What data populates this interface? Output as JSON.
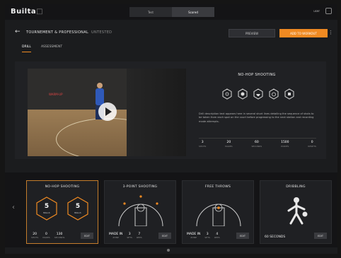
{
  "app": {
    "logo": "Builta",
    "logo_suffix": "□"
  },
  "top_nav": {
    "modes": [
      "Test",
      "Scored"
    ],
    "active_index": 1,
    "right_label": "user"
  },
  "header": {
    "back_icon": "arrow-left-icon",
    "title": "TOURNEMENT & PROFESSIONAL",
    "subtitle": "UNTESTED",
    "secondary_button": "PREVIEW",
    "primary_button": "ADD TO WORKOUT",
    "more_icon": "more-vertical-icon"
  },
  "tabs": [
    {
      "label": "DRILL",
      "active": true
    },
    {
      "label": "ASSESSMENT",
      "active": false
    }
  ],
  "video": {
    "overlay_text": "WARM-UP",
    "play_icon": "play-icon"
  },
  "drill_info": {
    "title": "NO-HOP SHOOTING",
    "icons": [
      "court-icon",
      "ball-icon",
      "hoop-icon",
      "timer-icon",
      "target-icon"
    ],
    "description": "Drill description text appears here in several short lines detailing the sequence of shots to be taken from each spot on the court before progressing to the next station and recording made attempts.",
    "stats": [
      {
        "value": "3",
        "label": "SHOTS"
      },
      {
        "value": "20",
        "label": "MAKES"
      },
      {
        "value": "60",
        "label": "SECONDS"
      },
      {
        "value": "1500",
        "label": "POINTS"
      },
      {
        "value": "0",
        "label": "RESETS"
      }
    ]
  },
  "cards": [
    {
      "title": "NO-HOP SHOOTING",
      "active": true,
      "hexes": [
        {
          "value": "5",
          "label": "BALLS"
        },
        {
          "value": "5",
          "label": "BALLS"
        }
      ],
      "footer_stats": [
        {
          "value": "20",
          "label": "SHOTS"
        },
        {
          "value": "0",
          "label": "MAKES"
        },
        {
          "value": "130",
          "label": "SECONDS"
        }
      ],
      "button": "EDIT"
    },
    {
      "title": "3-POINT SHOOTING",
      "active": false,
      "footer_stats": [
        {
          "value": "MADE IN",
          "label": "ZONE"
        },
        {
          "value": "3",
          "label": "SETS"
        },
        {
          "value": "7",
          "label": "REPS"
        }
      ],
      "button": "EDIT"
    },
    {
      "title": "FREE THROWS",
      "active": false,
      "footer_stats": [
        {
          "value": "MADE IN",
          "label": "ZONE"
        },
        {
          "value": "3",
          "label": "SETS"
        },
        {
          "value": "4",
          "label": "REPS"
        }
      ],
      "button": "EDIT"
    },
    {
      "title": "DRIBBLING",
      "active": false,
      "big_label": "60 SECONDS",
      "button": "EDIT"
    }
  ],
  "colors": {
    "accent": "#f08a22",
    "background": "#1b1c1e"
  }
}
